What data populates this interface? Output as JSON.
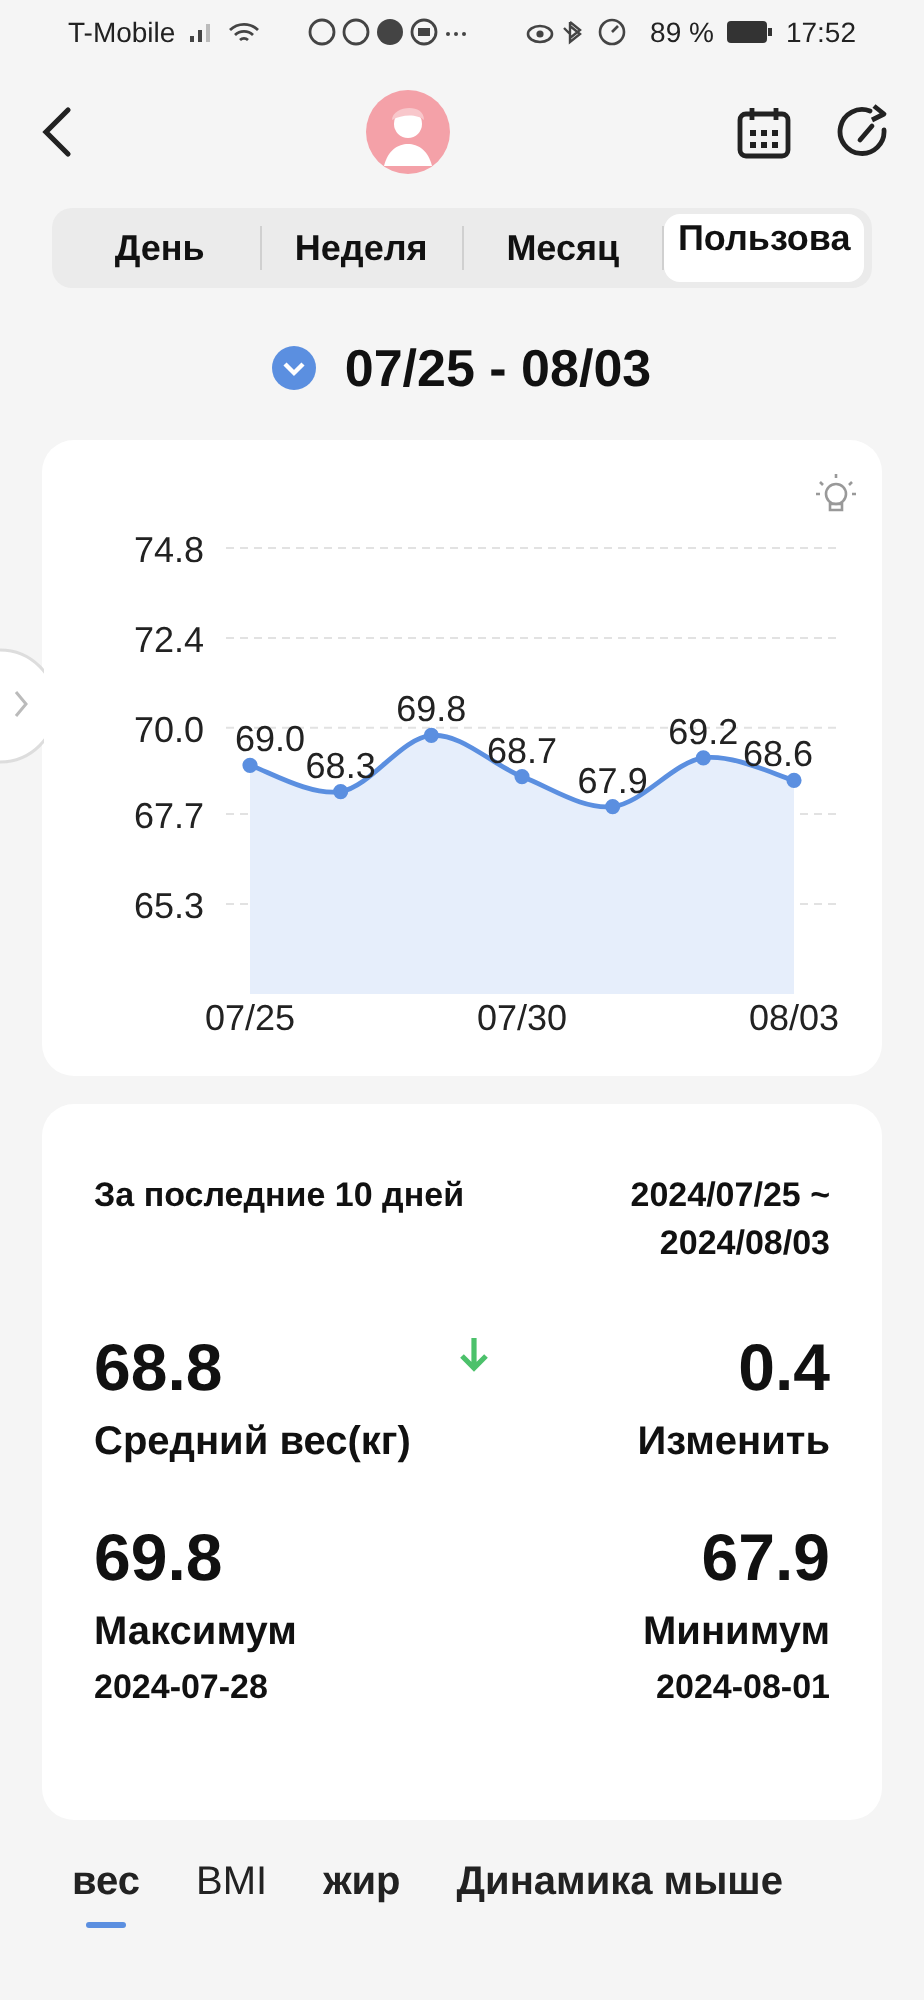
{
  "status_bar": {
    "carrier": "T-Mobile",
    "battery": "89 %",
    "time": "17:52"
  },
  "period_tabs": [
    {
      "label": "День",
      "selected": false
    },
    {
      "label": "Неделя",
      "selected": false
    },
    {
      "label": "Месяц",
      "selected": false
    },
    {
      "label": "Пользова",
      "selected": true
    }
  ],
  "date_range": "07/25 - 08/03",
  "chart": {
    "chart_data": {
      "type": "area",
      "grid": true,
      "categories": [
        "07/25",
        null,
        null,
        "07/30",
        null,
        null,
        "08/03"
      ],
      "series": [
        {
          "color": "#5b8fe0",
          "values": [
            69.0,
            68.3,
            69.8,
            68.7,
            67.9,
            69.2,
            68.6
          ]
        }
      ],
      "yticks": [
        74.8,
        72.4,
        {
          "value": 70.0,
          "label": "70.0"
        },
        67.7,
        65.3
      ],
      "ylim": [
        62.9,
        74.8
      ],
      "value_labels": [
        "69.0",
        "68.3",
        "69.8",
        "68.7",
        "67.9",
        "69.2",
        "68.6"
      ]
    }
  },
  "summary": {
    "period": "За последние 10 дней",
    "range": "2024/07/25 ~ 2024/08/03",
    "stats": [
      {
        "value": "68.8",
        "label": "Средний вес(кг)"
      },
      {
        "value": "0.4",
        "label": "Изменить",
        "decreased": true
      },
      {
        "value": "69.8",
        "label": "Максимум",
        "date": "2024-07-28"
      },
      {
        "value": "67.9",
        "label": "Минимум",
        "date": "2024-08-01"
      }
    ]
  },
  "metric_tabs": [
    {
      "label": "вес",
      "selected": true
    },
    {
      "label": "BMI",
      "selected": false
    },
    {
      "label": "жир",
      "selected": false
    },
    {
      "label": "Динамика мыше",
      "selected": false
    }
  ]
}
